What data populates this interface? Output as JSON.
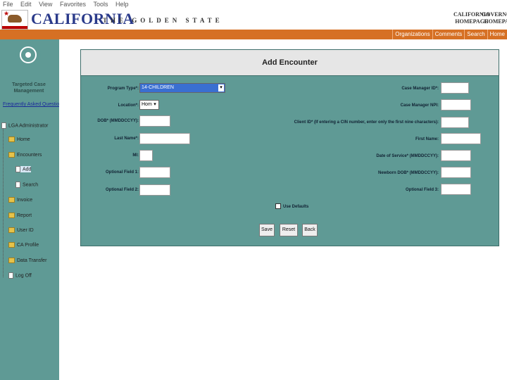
{
  "menubar": [
    "File",
    "Edit",
    "View",
    "Favorites",
    "Tools",
    "Help"
  ],
  "header": {
    "brand": "CALIFORNIA",
    "tagline": "THE GOLDEN STATE",
    "link1_line1": "CALIFORNIA",
    "link1_line2": "HOMEPAGE",
    "link2_line1": "GOVERNOR'S",
    "link2_line2": "HOMEPAGE"
  },
  "nav": [
    "Organizations",
    "Comments",
    "Search",
    "Home"
  ],
  "sidebar": {
    "logo_title": "Targeted Case Management",
    "faq": "Frequently Asked Questions",
    "tree": {
      "root": "LGA Administrator",
      "home": "Home",
      "encounters": "Encounters",
      "add": "Add",
      "search": "Search",
      "invoice": "Invoice",
      "report": "Report",
      "user_id": "User ID",
      "ca_profile": "CA Profile",
      "data_transfer": "Data Transfer",
      "log_off": "Log Off"
    }
  },
  "form": {
    "title": "Add Encounter",
    "program_type_label": "Program Type*:",
    "program_type_value": "14-CHILDREN",
    "location_label": "Location*:",
    "location_value": "Home",
    "dob_label": "DOB* (MMDDCCYY):",
    "last_name_label": "Last Name*:",
    "mi_label": "MI:",
    "opt1_label": "Optional Field 1:",
    "opt2_label": "Optional Field 2:",
    "cm_id_label": "Case Manager ID*:",
    "cm_npi_label": "Case Manager NPI:",
    "client_id_label": "Client ID* (If entering a CIN number, enter only the first nine characters):",
    "first_name_label": "First Name:",
    "dos_label": "Date of Service* (MMDDCCYY):",
    "newborn_label": "Newborn DOB* (MMDDCCYY):",
    "opt3_label": "Optional Field 3:",
    "defaults_label": "Use Defaults",
    "save": "Save",
    "reset": "Reset",
    "back": "Back"
  }
}
